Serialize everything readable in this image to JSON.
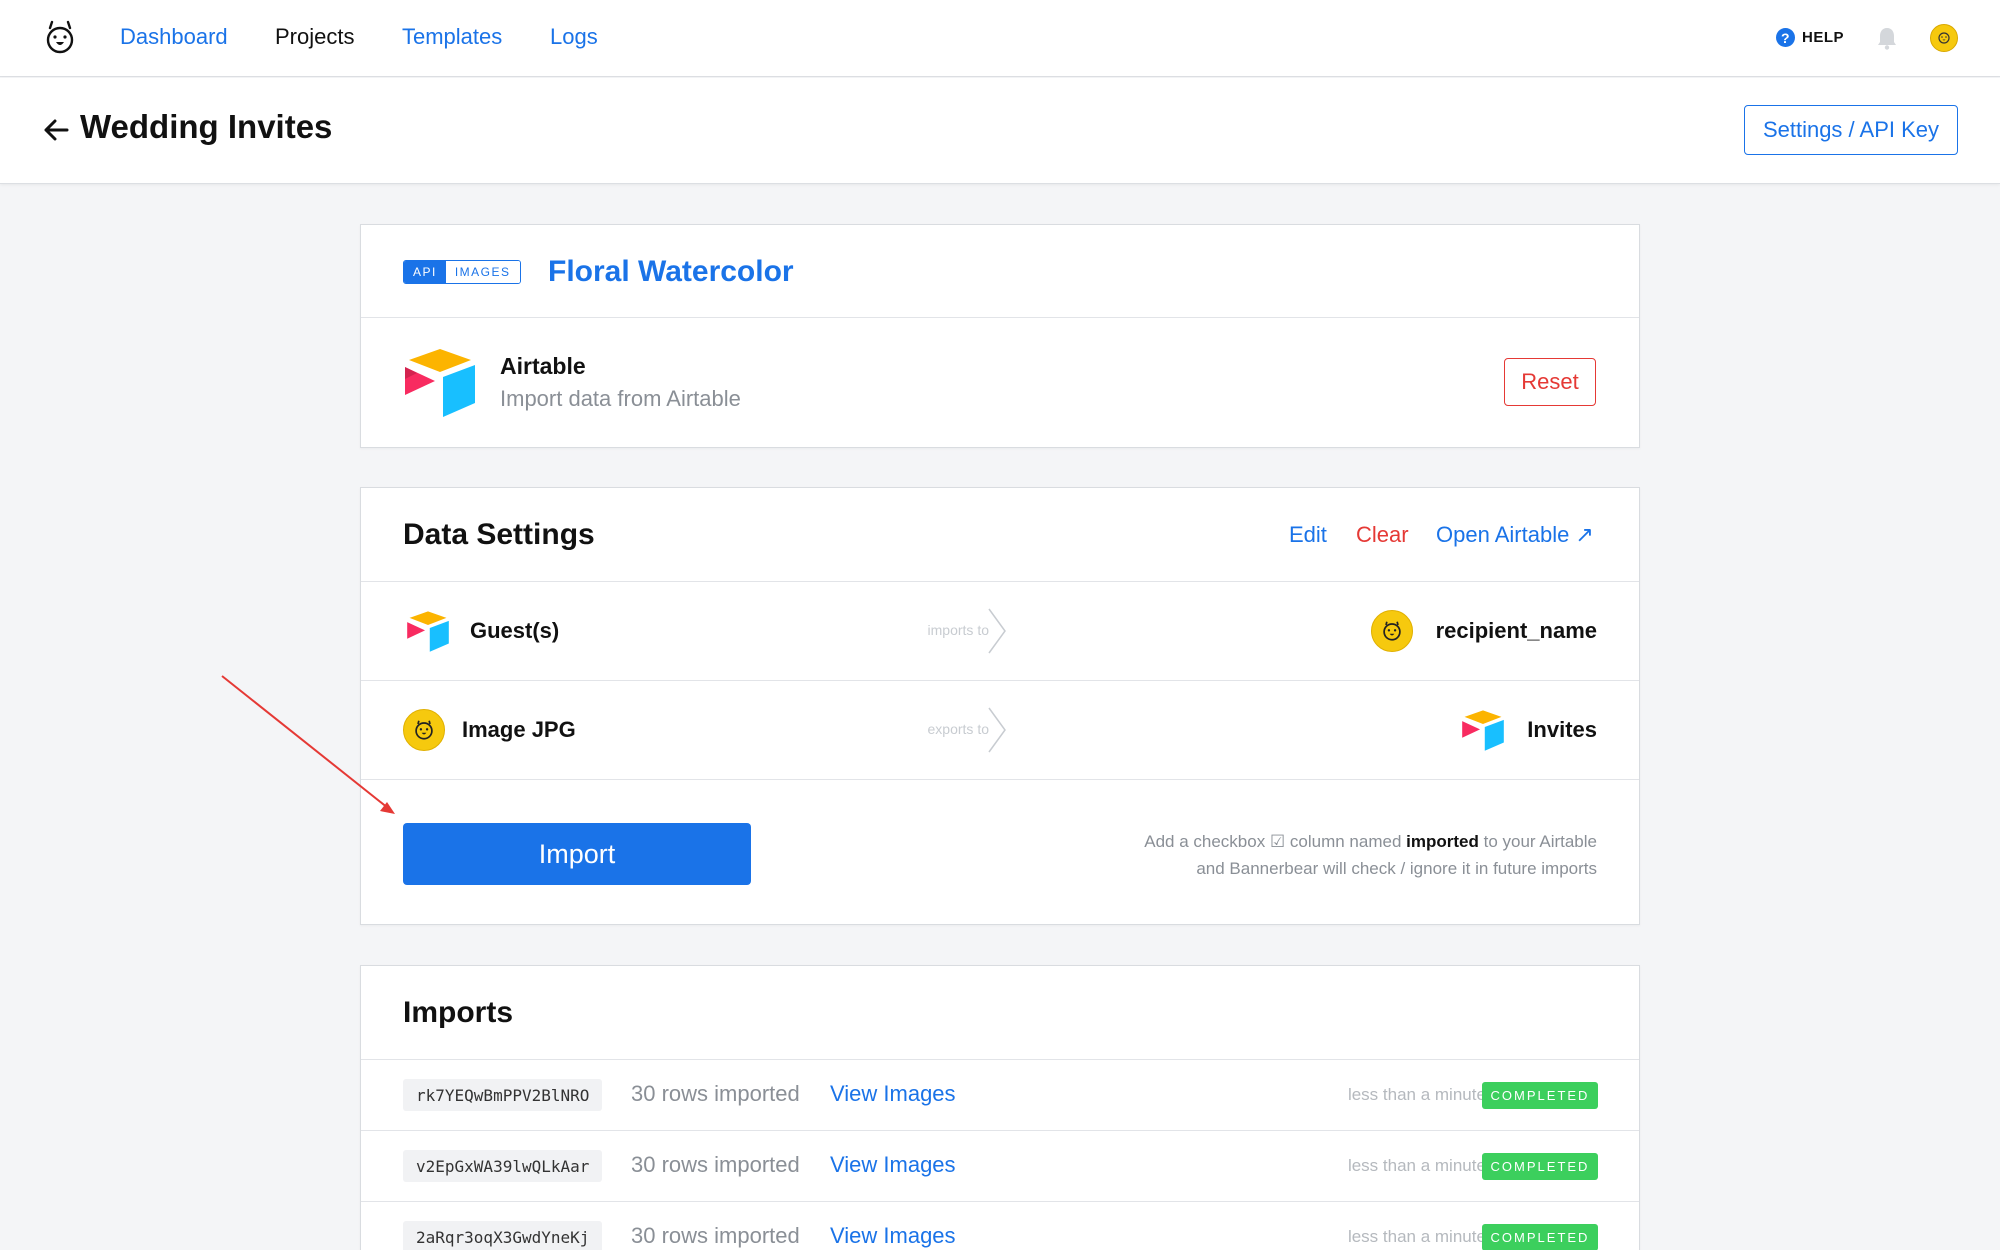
{
  "nav": {
    "links": [
      {
        "label": "Dashboard"
      },
      {
        "label": "Projects"
      },
      {
        "label": "Templates"
      },
      {
        "label": "Logs"
      }
    ],
    "help_label": "HELP",
    "help_glyph": "?"
  },
  "header": {
    "title": "Wedding Invites",
    "settings_label": "Settings / API Key"
  },
  "template_card": {
    "badge_api": "API",
    "badge_images": "IMAGES",
    "name": "Floral Watercolor",
    "source_title": "Airtable",
    "source_subtitle": "Import data from Airtable",
    "reset_label": "Reset"
  },
  "data_settings": {
    "title": "Data Settings",
    "edit_label": "Edit",
    "clear_label": "Clear",
    "open_label": "Open Airtable ↗",
    "mappings": [
      {
        "left": "Guest(s)",
        "mid": "imports to",
        "right": "recipient_name"
      },
      {
        "left": "Image JPG",
        "mid": "exports to",
        "right": "Invites"
      }
    ],
    "import_label": "Import",
    "hint_pre": "Add a checkbox ☑ column named ",
    "hint_bold": "imported",
    "hint_post": " to your Airtable",
    "hint_line2": "and Bannerbear will check / ignore it in future imports"
  },
  "imports": {
    "title": "Imports",
    "rows": [
      {
        "id": "rk7YEQwBmPPV2BlNRO",
        "count": "30 rows imported",
        "view": "View Images",
        "time": "less than a minute ago",
        "status": "COMPLETED"
      },
      {
        "id": "v2EpGxWA39lwQLkAar",
        "count": "30 rows imported",
        "view": "View Images",
        "time": "less than a minute ago",
        "status": "COMPLETED"
      },
      {
        "id": "2aRqr3oqX3GwdYneKj",
        "count": "30 rows imported",
        "view": "View Images",
        "time": "less than a minute ago",
        "status": "COMPLETED"
      }
    ]
  },
  "colors": {
    "accent": "#1a73e8",
    "danger": "#e53935",
    "success": "#3ccf5d",
    "bear_yellow": "#f6c90e",
    "annotation_arrow": "#e53935"
  },
  "icons": [
    "bear-logo-icon",
    "help-icon",
    "bell-icon",
    "back-arrow-icon",
    "airtable-icon",
    "bear-icon",
    "chevron-right-icon",
    "external-link-icon"
  ]
}
